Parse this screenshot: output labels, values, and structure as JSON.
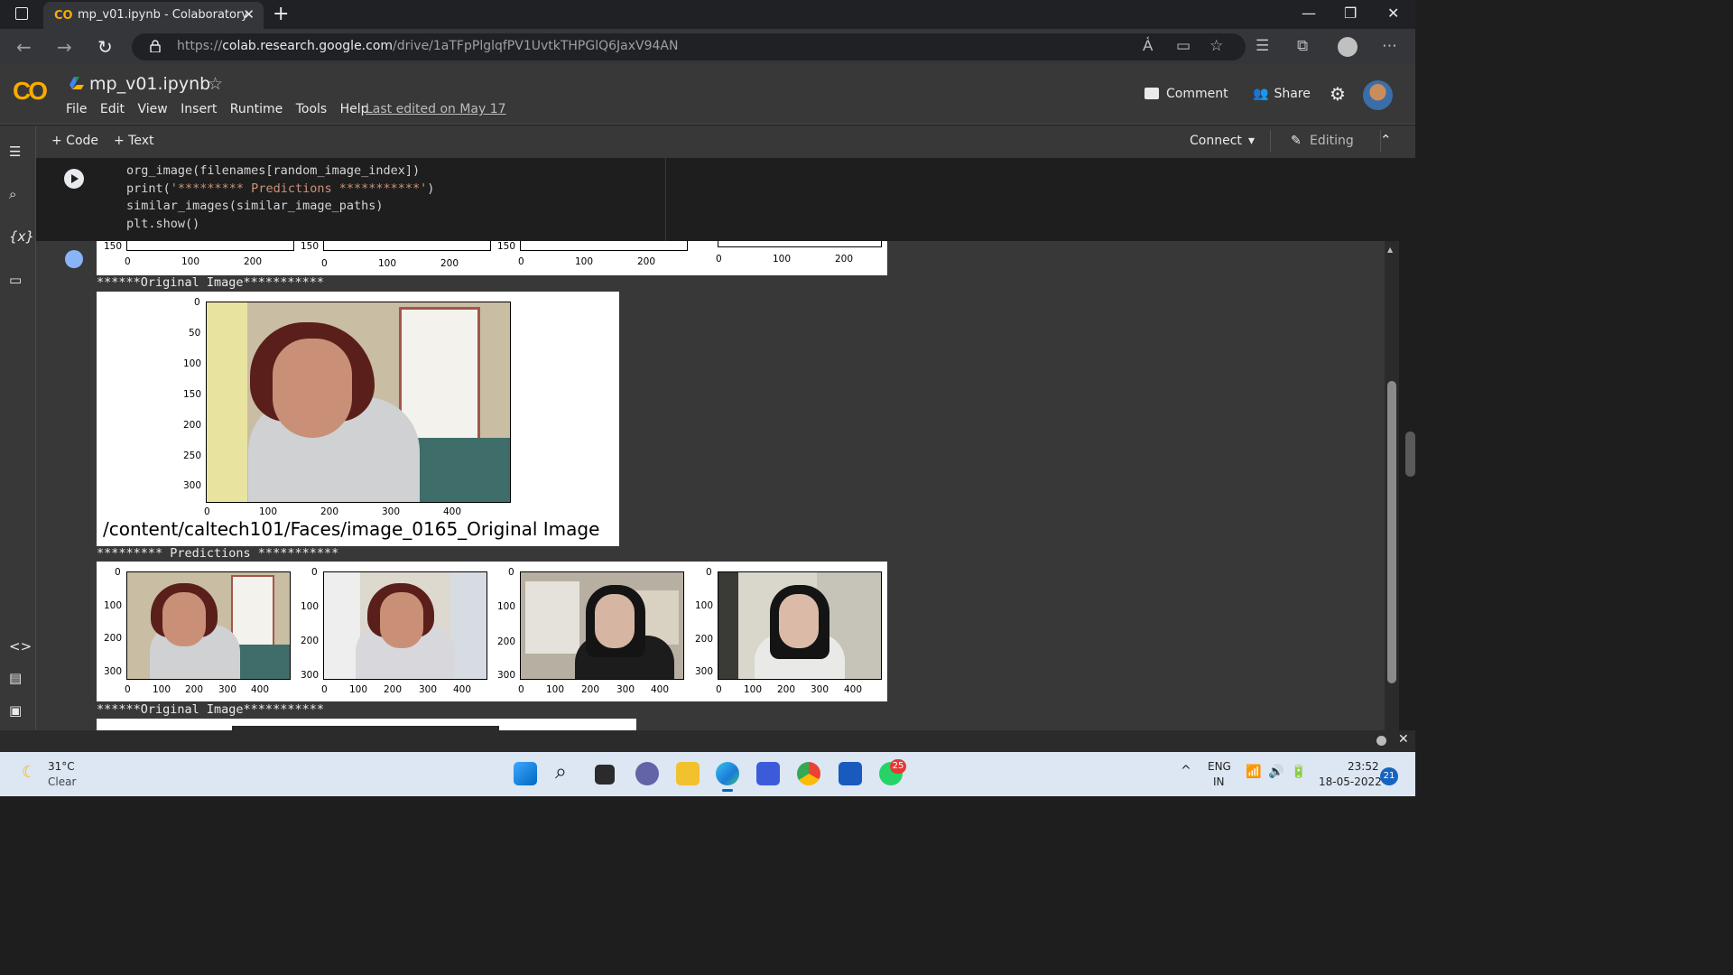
{
  "browser": {
    "tab_title": "mp_v01.ipynb - Colaboratory",
    "tab_favicon": "CO",
    "url_prefix": "https://",
    "url_host": "colab.research.google.com",
    "url_path": "/drive/1aTFpPlglqfPV1UvtkTHPGlQ6JaxV94AN"
  },
  "colab": {
    "notebook_name": "mp_v01.ipynb",
    "logo": "CO",
    "menu": [
      "File",
      "Edit",
      "View",
      "Insert",
      "Runtime",
      "Tools",
      "Help"
    ],
    "last_edited": "Last edited on May 17",
    "comment_label": "Comment",
    "share_label": "Share",
    "add_code": "+ Code",
    "add_text": "+ Text",
    "connect_label": "Connect",
    "editing_label": "Editing",
    "brand_color": "#f9ab00"
  },
  "code": {
    "line1": "org_image(filenames[random_image_index])",
    "line2_pre": "print(",
    "line2_str": "'********* Predictions ***********'",
    "line2_post": ")",
    "line3": "similar_images(similar_image_paths)",
    "line4": "plt.show()"
  },
  "output": {
    "top_row_ticks": [
      "150",
      "0",
      "100",
      "200"
    ],
    "original_header": "******Original Image***********",
    "predictions_header": "********* Predictions ***********",
    "original_yticks": [
      "0",
      "50",
      "100",
      "150",
      "200",
      "250",
      "300"
    ],
    "original_xticks": [
      "0",
      "100",
      "200",
      "300",
      "400"
    ],
    "original_caption": "/content/caltech101/Faces/image_0165_Original Image",
    "pred_yticks": [
      "0",
      "100",
      "200",
      "300"
    ],
    "pred_xticks": [
      "0",
      "100",
      "200",
      "300",
      "400"
    ],
    "original_header_2": "******Original Image***********"
  },
  "taskbar": {
    "weather_temp": "31°C",
    "weather_desc": "Clear",
    "lang_top": "ENG",
    "lang_bottom": "IN",
    "time": "23:52",
    "date": "18-05-2022",
    "notif_count": "21",
    "whatsapp_badge": "25"
  }
}
